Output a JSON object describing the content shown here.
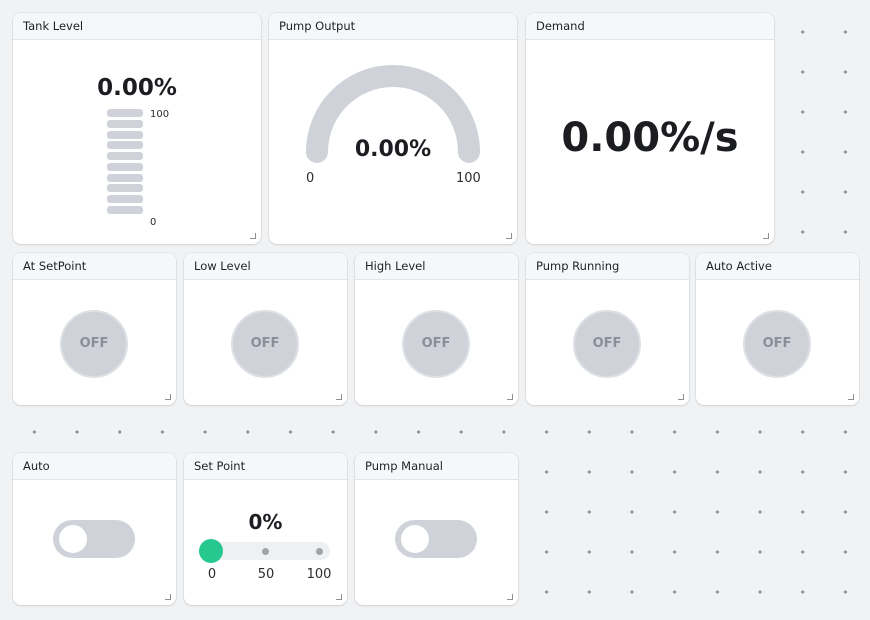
{
  "colors": {
    "accent": "#26c88f",
    "inactive": "#cfd3d9",
    "background": "#f1f2f4"
  },
  "tank": {
    "title": "Tank Level",
    "value": "0.00%",
    "max_label": "100",
    "min_label": "0",
    "level_fraction": 0
  },
  "pump_output": {
    "title": "Pump Output",
    "value": "0.00%",
    "min_label": "0",
    "max_label": "100",
    "level_fraction": 0
  },
  "demand": {
    "title": "Demand",
    "value": "0.00%/s"
  },
  "indicators": [
    {
      "title": "At SetPoint",
      "state": "OFF"
    },
    {
      "title": "Low Level",
      "state": "OFF"
    },
    {
      "title": "High Level",
      "state": "OFF"
    },
    {
      "title": "Pump Running",
      "state": "OFF"
    },
    {
      "title": "Auto Active",
      "state": "OFF"
    }
  ],
  "auto_switch": {
    "title": "Auto",
    "on": false
  },
  "set_point": {
    "title": "Set Point",
    "value": "0%",
    "ticks": [
      "0",
      "50",
      "100"
    ],
    "fraction": 0
  },
  "pump_manual": {
    "title": "Pump Manual",
    "on": false
  }
}
